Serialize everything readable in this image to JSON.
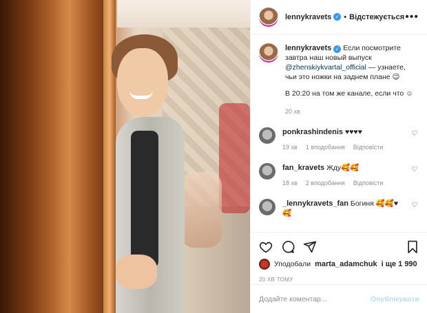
{
  "post": {
    "username": "lennykravets",
    "follow_label": "Відстежується",
    "caption_part1": "Если посмотрите завтра наш новый выпуск",
    "caption_mention": "@zhenskiykvartal_official",
    "caption_part2": "— узнаете, чьи это ножки на заднем плане 😉",
    "caption_para2": "В 20:20 на том же канале, если что ☺",
    "caption_time": "20 хв"
  },
  "comments": [
    {
      "username": "ponkrashindenis",
      "text": "♥♥♥♥",
      "time": "19 хв",
      "likes": "1 вподобання",
      "reply": "Відповісти"
    },
    {
      "username": "fan_kravets",
      "text": "Жду🥰🥰",
      "time": "18 хв",
      "likes": "2 вподобання",
      "reply": "Відповісти"
    },
    {
      "username": "_lennykravets_fan",
      "text": "Богиня 🥰🥰♥🥰"
    }
  ],
  "likes": {
    "prefix": "Уподобали",
    "user": "marta_adamchuk",
    "suffix": "і ще 1 990"
  },
  "ago": "20 ХВ ТОМУ",
  "add_comment": {
    "placeholder": "Додайте коментар...",
    "post_label": "Опублікувати"
  },
  "icons": {
    "verified": "✓",
    "more": "•••",
    "heart": "♡"
  },
  "colors": {
    "verified": "#3897f0",
    "mention": "#00376b",
    "post_button_disabled": "#b2dffc",
    "muted": "#8e8e8e"
  }
}
